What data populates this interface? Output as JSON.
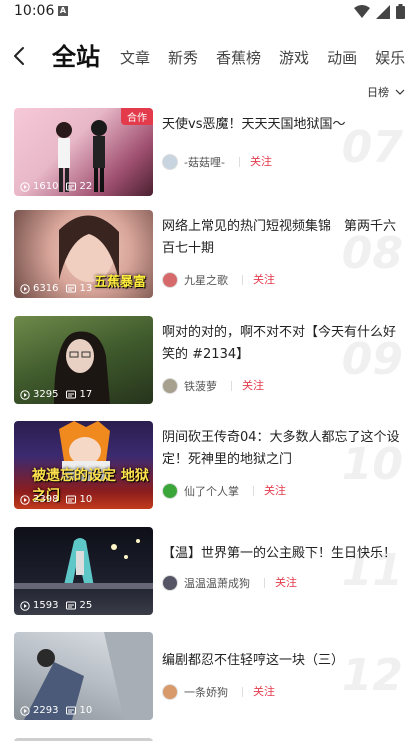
{
  "status_bar": {
    "time": "10:06",
    "notif_badge": "A"
  },
  "nav": {
    "tabs": [
      {
        "label": "全站"
      },
      {
        "label": "文章"
      },
      {
        "label": "新秀"
      },
      {
        "label": "香蕉榜"
      },
      {
        "label": "游戏"
      },
      {
        "label": "动画"
      },
      {
        "label": "娱乐"
      }
    ]
  },
  "rank_filter": {
    "label": "日榜"
  },
  "videos": [
    {
      "rank": "07",
      "title": "天使vs恶魔！天天天国地狱国～",
      "author": "-菇菇哩-",
      "follow": "关注",
      "plays": "1610",
      "comments": "22",
      "tag": "合作",
      "caption": ""
    },
    {
      "rank": "08",
      "title": "网络上常见的热门短视频集锦　第两千六百七十期",
      "author": "九星之歌",
      "follow": "关注",
      "plays": "6316",
      "comments": "13",
      "tag": "",
      "caption": "五蕉暴富"
    },
    {
      "rank": "09",
      "title": "啊对的对的，啊不对不对【今天有什么好笑的 #2134】",
      "author": "铁菠萝",
      "follow": "关注",
      "plays": "3295",
      "comments": "17",
      "tag": "",
      "caption": ""
    },
    {
      "rank": "10",
      "title": "阴间砍王传奇04：大多数人都忘了这个设定！死神里的地狱之门",
      "author": "仙了个人掌",
      "follow": "关注",
      "plays": "2398",
      "comments": "10",
      "tag": "",
      "caption": "被遗忘的设定 地狱之门"
    },
    {
      "rank": "11",
      "title": "【温】世界第一的公主殿下！生日快乐！",
      "author": "温温温萧成狗",
      "follow": "关注",
      "plays": "1593",
      "comments": "25",
      "tag": "",
      "caption": ""
    },
    {
      "rank": "12",
      "title": "编剧都忍不住轻哼这一块（三）",
      "author": "一条娇狗",
      "follow": "关注",
      "plays": "2293",
      "comments": "10",
      "tag": "",
      "caption": ""
    }
  ]
}
